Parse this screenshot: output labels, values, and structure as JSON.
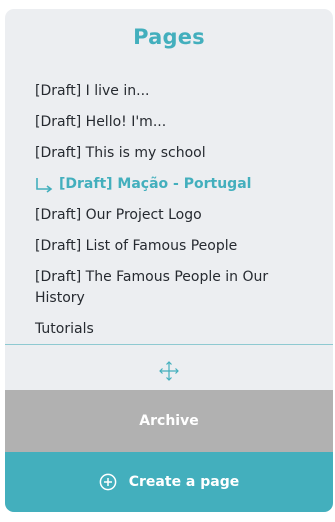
{
  "panel": {
    "title": "Pages",
    "pages": [
      {
        "label": "[Draft] I live in..."
      },
      {
        "label": "[Draft] Hello! I'm..."
      },
      {
        "label": "[Draft] This is my school"
      },
      {
        "label": "[Draft] Mação - Portugal"
      },
      {
        "label": "[Draft] Our Project Logo"
      },
      {
        "label": "[Draft] List of Famous People"
      },
      {
        "label": "[Draft] The Famous People in Our History"
      },
      {
        "label": "Tutorials"
      }
    ],
    "archive_label": "Archive",
    "create_label": "Create a page"
  },
  "icons": {
    "sub_page_indicator": "subpage-arrow-icon",
    "move_handle": "move-arrows-icon",
    "create": "plus-circle-icon"
  },
  "colors": {
    "accent": "#43afbd",
    "panel_background": "#eceef1",
    "archive_background": "#b1b1b1",
    "text": "#262a30"
  }
}
